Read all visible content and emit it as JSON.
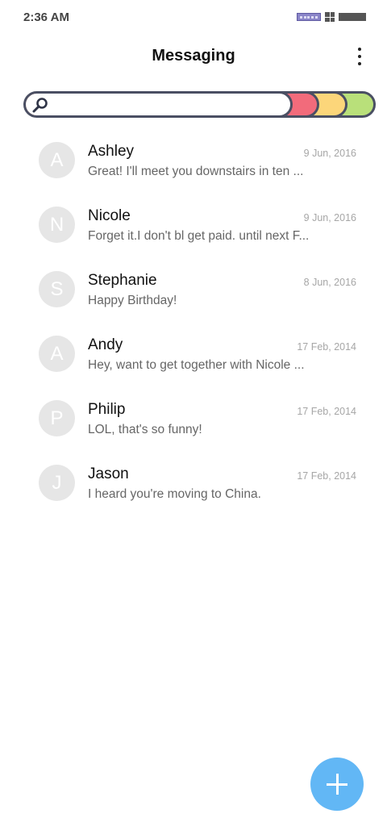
{
  "status_bar": {
    "time": "2:36 AM"
  },
  "header": {
    "title": "Messaging"
  },
  "search": {
    "placeholder": "",
    "value": "",
    "colors": [
      "#f26b7b",
      "#fcd67a",
      "#b9e07a"
    ]
  },
  "conversations": [
    {
      "initial": "A",
      "name": "Ashley",
      "date": "9 Jun, 2016",
      "preview": "Great! I'll meet you downstairs in ten ..."
    },
    {
      "initial": "N",
      "name": "Nicole",
      "date": "9 Jun, 2016",
      "preview": "Forget it.I don't bl get paid. until next F..."
    },
    {
      "initial": "S",
      "name": "Stephanie",
      "date": "8 Jun, 2016",
      "preview": "Happy Birthday!"
    },
    {
      "initial": "A",
      "name": "Andy",
      "date": "17 Feb, 2014",
      "preview": "Hey, want to get together with Nicole ..."
    },
    {
      "initial": "P",
      "name": "Philip",
      "date": "17 Feb, 2014",
      "preview": "LOL, that's so funny!"
    },
    {
      "initial": "J",
      "name": "Jason",
      "date": "17 Feb, 2014",
      "preview": "I heard you're moving to China."
    }
  ],
  "fab": {
    "icon": "plus-icon",
    "color": "#62b7f5"
  }
}
